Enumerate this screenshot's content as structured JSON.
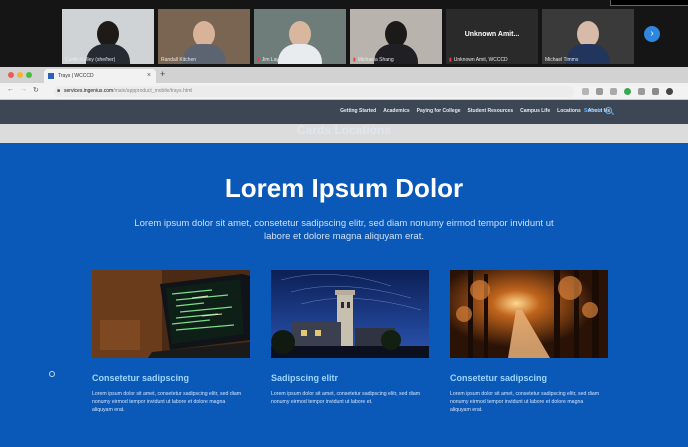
{
  "call": {
    "participants": [
      {
        "name": "Caitlin Kelley (she/her)",
        "muted": false
      },
      {
        "name": "Randall Kitchen",
        "muted": false
      },
      {
        "name": "Jim Lay",
        "muted": true
      },
      {
        "name": "Michaela Shang",
        "muted": true
      },
      {
        "name": "Unknown Amit, WCCCD",
        "muted": true
      },
      {
        "name": "Michael Timms",
        "muted": false
      }
    ],
    "placeholder_label": "Unknown Amit..."
  },
  "browser": {
    "tab_title": "Trays | WCCCD",
    "url_domain": "services.ingenius.com",
    "url_path": "/main/appproduct_mobile/trays.html"
  },
  "site": {
    "nav": [
      "Getting Started",
      "Academics",
      "Paying for College",
      "Student Resources",
      "Campus Life",
      "Locations",
      "About Us"
    ],
    "search_label": "Search",
    "page_heading": "Cards Locations",
    "hero_title": "Lorem Ipsum Dolor",
    "hero_text": "Lorem ipsum dolor sit amet, consetetur sadipscing elitr, sed diam nonumy eirmod tempor invidunt ut labore et dolore magna aliquyam erat.",
    "cards": [
      {
        "title": "Consetetur sadipscing",
        "text": "Lorem ipsum dolor sit amet, consetetur sadipscing elitr, sed diam nonumy eirmod tempor invidunt ut labore et dolore magna aliquyam erat.",
        "image": "laptop-code-photo"
      },
      {
        "title": "Sadipscing elitr",
        "text": "Lorem ipsum dolor sit amet, consetetur sadipscing elitr, sed diam nonumy eirmod tempor invidunt ut labore et.",
        "image": "campus-tower-night-photo"
      },
      {
        "title": "Consetetur sadipscing",
        "text": "Lorem ipsum dolor sit amet, consetetur sadipscing elitr, sed diam nonumy eirmod tempor invidunt ut labore et dolore magna aliquyam erat.",
        "image": "autumn-path-photo"
      }
    ]
  },
  "colors": {
    "hero_bg": "#0a58b8",
    "nav_bg": "#3c4654",
    "card_title": "#9cd7ff"
  }
}
